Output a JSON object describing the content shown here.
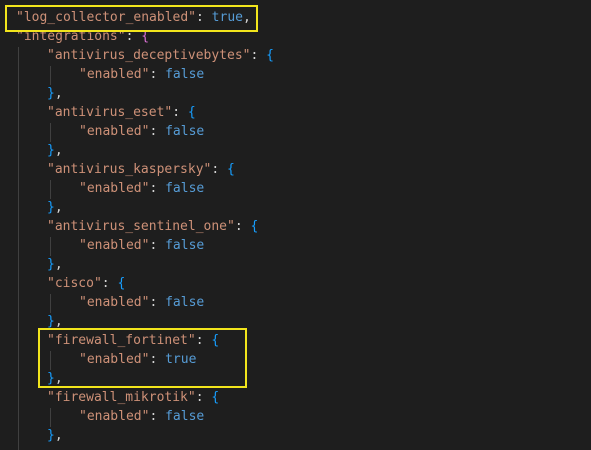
{
  "colors": {
    "background": "#1e1e1e",
    "string_key": "#ce9178",
    "literal": "#569cd6",
    "punctuation": "#d4d4d4",
    "highlight_box": "#f2e51c",
    "indent_guide": "#404040"
  },
  "lines": {
    "l1": {
      "key": "\"log_collector_enabled\"",
      "sep": ": ",
      "value": "true",
      "tail": ","
    },
    "l2": {
      "key": "\"integrations\"",
      "sep": ": ",
      "open": "{"
    },
    "l3": {
      "key": "\"antivirus_deceptivebytes\"",
      "sep": ": ",
      "open": "{"
    },
    "l4": {
      "key": "\"enabled\"",
      "sep": ": ",
      "value": "false"
    },
    "l5": {
      "close": "}",
      "tail": ","
    },
    "l6": {
      "key": "\"antivirus_eset\"",
      "sep": ": ",
      "open": "{"
    },
    "l7": {
      "key": "\"enabled\"",
      "sep": ": ",
      "value": "false"
    },
    "l8": {
      "close": "}",
      "tail": ","
    },
    "l9": {
      "key": "\"antivirus_kaspersky\"",
      "sep": ": ",
      "open": "{"
    },
    "l10": {
      "key": "\"enabled\"",
      "sep": ": ",
      "value": "false"
    },
    "l11": {
      "close": "}",
      "tail": ","
    },
    "l12": {
      "key": "\"antivirus_sentinel_one\"",
      "sep": ": ",
      "open": "{"
    },
    "l13": {
      "key": "\"enabled\"",
      "sep": ": ",
      "value": "false"
    },
    "l14": {
      "close": "}",
      "tail": ","
    },
    "l15": {
      "key": "\"cisco\"",
      "sep": ": ",
      "open": "{"
    },
    "l16": {
      "key": "\"enabled\"",
      "sep": ": ",
      "value": "false"
    },
    "l17": {
      "close": "}",
      "tail": ","
    },
    "l18": {
      "key": "\"firewall_fortinet\"",
      "sep": ": ",
      "open": "{"
    },
    "l19": {
      "key": "\"enabled\"",
      "sep": ": ",
      "value": "true"
    },
    "l20": {
      "close": "}",
      "tail": ","
    },
    "l21": {
      "key": "\"firewall_mikrotik\"",
      "sep": ": ",
      "open": "{"
    },
    "l22": {
      "key": "\"enabled\"",
      "sep": ": ",
      "value": "false"
    },
    "l23": {
      "close": "}",
      "tail": ","
    }
  }
}
